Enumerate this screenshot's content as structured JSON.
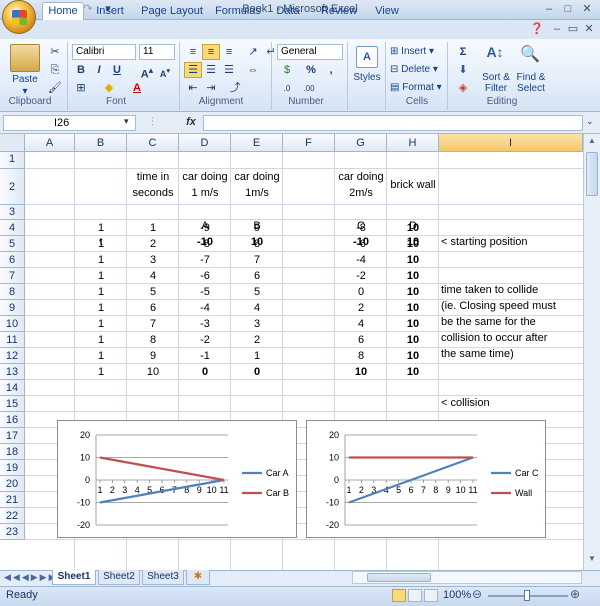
{
  "window": {
    "title": "Book1 - Microsoft Excel"
  },
  "ribbon_tabs": [
    "Home",
    "Insert",
    "Page Layout",
    "Formulas",
    "Data",
    "Review",
    "View"
  ],
  "clipboard": {
    "paste": "Paste",
    "label": "Clipboard"
  },
  "font": {
    "name": "Calibri",
    "size": "11",
    "label": "Font"
  },
  "alignment": {
    "label": "Alignment"
  },
  "number": {
    "format": "General",
    "label": "Number"
  },
  "styles": {
    "button": "Styles"
  },
  "cells": {
    "insert": "Insert",
    "delete": "Delete",
    "format": "Format",
    "label": "Cells"
  },
  "editing": {
    "sort": "Sort &",
    "sort2": "Filter",
    "find": "Find &",
    "find2": "Select",
    "label": "Editing"
  },
  "formula_bar": {
    "name_box": "I26",
    "fx": "fx"
  },
  "columns": [
    "A",
    "B",
    "C",
    "D",
    "E",
    "F",
    "G",
    "H",
    "I"
  ],
  "rows": [
    "1",
    "2",
    "3",
    "4",
    "5",
    "6",
    "7",
    "8",
    "9",
    "10",
    "11",
    "12",
    "13",
    "14",
    "15",
    "16",
    "17",
    "18",
    "19",
    "20",
    "21",
    "22",
    "23"
  ],
  "headers": {
    "c1a": "time in",
    "c1b": "seconds",
    "d1a": "car doing",
    "d1b": "1 m/s",
    "e1a": "car doing",
    "e1b": "1m/s",
    "g1a": "car doing",
    "g1b": "2m/s",
    "h1": "brick wall",
    "d2": "A",
    "e2": "B",
    "g2": "C",
    "h2": "D"
  },
  "table": {
    "b3": "t",
    "d3": "-10",
    "e3": "10",
    "g3": "-10",
    "h3": "10",
    "i3": "< starting position",
    "rows": [
      [
        "1",
        "1",
        "-9",
        "9",
        "-8",
        "10"
      ],
      [
        "1",
        "2",
        "-8",
        "8",
        "-6",
        "10"
      ],
      [
        "1",
        "3",
        "-7",
        "7",
        "-4",
        "10"
      ],
      [
        "1",
        "4",
        "-6",
        "6",
        "-2",
        "10"
      ],
      [
        "1",
        "5",
        "-5",
        "5",
        "0",
        "10"
      ],
      [
        "1",
        "6",
        "-4",
        "4",
        "2",
        "10"
      ],
      [
        "1",
        "7",
        "-3",
        "3",
        "4",
        "10"
      ],
      [
        "1",
        "8",
        "-2",
        "2",
        "6",
        "10"
      ],
      [
        "1",
        "9",
        "-1",
        "1",
        "8",
        "10"
      ],
      [
        "1",
        "10",
        "0",
        "0",
        "10",
        "10"
      ]
    ],
    "i13": "< collision",
    "note": [
      "time taken to collide",
      "(ie. Closing speed must",
      "be the same for the",
      "collision to occur after",
      "the same time)"
    ]
  },
  "chart_data": [
    {
      "type": "line",
      "x": [
        1,
        2,
        3,
        4,
        5,
        6,
        7,
        8,
        9,
        10,
        11
      ],
      "categories": [
        "1",
        "2",
        "3",
        "4",
        "5",
        "6",
        "7",
        "8",
        "9",
        "10",
        "11"
      ],
      "series": [
        {
          "name": "Car A",
          "color": "#4f81bd",
          "values": [
            -10,
            -9,
            -8,
            -7,
            -6,
            -5,
            -4,
            -3,
            -2,
            -1,
            0
          ]
        },
        {
          "name": "Car B",
          "color": "#c0504d",
          "values": [
            10,
            9,
            8,
            7,
            6,
            5,
            4,
            3,
            2,
            1,
            0
          ]
        }
      ],
      "ylim": [
        -20,
        20
      ],
      "yticks": [
        "20",
        "10",
        "0",
        "-10",
        "-20"
      ],
      "legend": "right",
      "grid": true
    },
    {
      "type": "line",
      "x": [
        1,
        2,
        3,
        4,
        5,
        6,
        7,
        8,
        9,
        10,
        11
      ],
      "categories": [
        "1",
        "2",
        "3",
        "4",
        "5",
        "6",
        "7",
        "8",
        "9",
        "10",
        "11"
      ],
      "series": [
        {
          "name": "Car C",
          "color": "#4f81bd",
          "values": [
            -10,
            -8,
            -6,
            -4,
            -2,
            0,
            2,
            4,
            6,
            8,
            10
          ]
        },
        {
          "name": "Wall",
          "color": "#c0504d",
          "values": [
            10,
            10,
            10,
            10,
            10,
            10,
            10,
            10,
            10,
            10,
            10
          ]
        }
      ],
      "ylim": [
        -20,
        20
      ],
      "yticks": [
        "20",
        "10",
        "0",
        "-10",
        "-20"
      ],
      "legend": "right",
      "grid": true
    }
  ],
  "sheets": [
    "Sheet1",
    "Sheet2",
    "Sheet3"
  ],
  "status": {
    "ready": "Ready",
    "zoom": "100%"
  }
}
